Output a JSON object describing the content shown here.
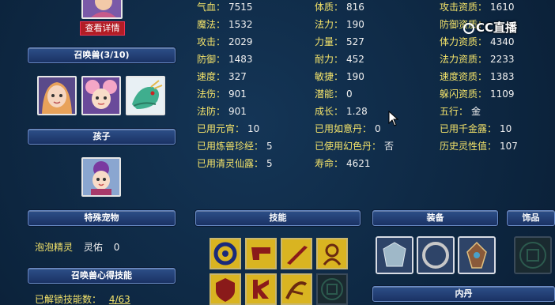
{
  "header": {
    "view_details": "查看详情"
  },
  "left": {
    "summon_title": "召唤兽(3/10)",
    "child_title": "孩子",
    "special_pet_title": "特殊宠物",
    "pet_name": "泡泡精灵",
    "spirit_label": "灵佑",
    "spirit_value": "0",
    "skill_title": "召唤兽心得技能",
    "unlocked_label": "已解锁技能数：",
    "unlocked_value": "4/63"
  },
  "stats": {
    "col1": [
      {
        "k": "气血：",
        "v": "7515"
      },
      {
        "k": "魔法：",
        "v": "1532"
      },
      {
        "k": "攻击：",
        "v": "2029"
      },
      {
        "k": "防御：",
        "v": "1483"
      },
      {
        "k": "速度：",
        "v": "327"
      },
      {
        "k": "法伤：",
        "v": "901"
      },
      {
        "k": "法防：",
        "v": "901"
      },
      {
        "k": "已用元宵：",
        "v": "10"
      },
      {
        "k": "已用炼兽珍经：",
        "v": "5"
      },
      {
        "k": "已用清灵仙露：",
        "v": "5"
      }
    ],
    "col2": [
      {
        "k": "体质：",
        "v": "816"
      },
      {
        "k": "法力：",
        "v": "190"
      },
      {
        "k": "力量：",
        "v": "527"
      },
      {
        "k": "耐力：",
        "v": "452"
      },
      {
        "k": "敏捷：",
        "v": "190"
      },
      {
        "k": "潜能：",
        "v": "0"
      },
      {
        "k": "成长：",
        "v": "1.28"
      },
      {
        "k": "已用如意丹：",
        "v": "0"
      },
      {
        "k": "已使用幻色丹：",
        "v": "否"
      },
      {
        "k": "寿命：",
        "v": "4621"
      }
    ],
    "col3": [
      {
        "k": "攻击资质：",
        "v": "1610"
      },
      {
        "k": "防御资质：",
        "v": ""
      },
      {
        "k": "体力资质：",
        "v": "4340"
      },
      {
        "k": "法力资质：",
        "v": "2233"
      },
      {
        "k": "速度资质：",
        "v": "1383"
      },
      {
        "k": "躲闪资质：",
        "v": "1109"
      },
      {
        "k": "五行：",
        "v": "金"
      },
      {
        "k": "已用千金露：",
        "v": "10"
      },
      {
        "k": "历史灵性值：",
        "v": "107"
      }
    ]
  },
  "bottom": {
    "skills_title": "技能",
    "equip_title": "装备",
    "accessory_title": "饰品",
    "inner_title": "内丹"
  },
  "watermark": "CC直播",
  "colors": {
    "label": "#f5e46a",
    "value": "#f1f1f1",
    "bar": "#1a3264",
    "bg": "#0e2a44"
  }
}
